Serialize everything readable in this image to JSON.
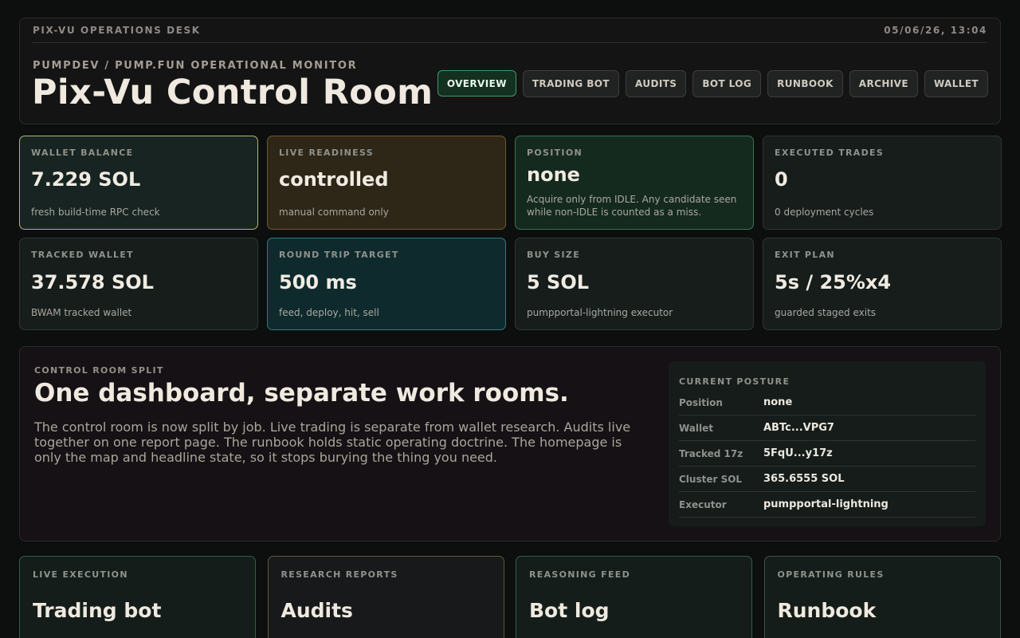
{
  "header": {
    "desk": "PIX-VU OPERATIONS DESK",
    "timestamp": "05/06/26, 13:04",
    "subtitle": "PUMPDEV / PUMP.FUN OPERATIONAL MONITOR",
    "title": "Pix-Vu Control Room"
  },
  "nav": {
    "tabs": [
      {
        "label": "OVERVIEW",
        "active": true
      },
      {
        "label": "TRADING BOT"
      },
      {
        "label": "AUDITS"
      },
      {
        "label": "BOT LOG"
      },
      {
        "label": "RUNBOOK"
      },
      {
        "label": "ARCHIVE"
      },
      {
        "label": "WALLET"
      }
    ]
  },
  "cards": [
    {
      "label": "WALLET BALANCE",
      "value": "7.229 SOL",
      "note": "fresh build-time RPC check"
    },
    {
      "label": "LIVE READINESS",
      "value": "controlled",
      "note": "manual command only"
    },
    {
      "label": "POSITION",
      "value": "none",
      "note": "Acquire only from IDLE. Any candidate seen while non-IDLE is counted as a miss."
    },
    {
      "label": "EXECUTED TRADES",
      "value": "0",
      "note": "0 deployment cycles"
    },
    {
      "label": "TRACKED WALLET",
      "value": "37.578 SOL",
      "note": "BWAM tracked wallet"
    },
    {
      "label": "ROUND TRIP TARGET",
      "value": "500 ms",
      "note": "feed, deploy, hit, sell"
    },
    {
      "label": "BUY SIZE",
      "value": "5 SOL",
      "note": "pumpportal-lightning executor"
    },
    {
      "label": "EXIT PLAN",
      "value": "5s / 25%x4",
      "note": "guarded staged exits"
    }
  ],
  "split": {
    "label": "CONTROL ROOM SPLIT",
    "title": "One dashboard, separate work rooms.",
    "body": "The control room is now split by job. Live trading is separate from wallet research. Audits live together on one report page. The runbook holds static operating doctrine. The homepage is only the map and headline state, so it stops burying the thing you need."
  },
  "posture": {
    "label": "CURRENT POSTURE",
    "rows": [
      {
        "key": "Position",
        "value": "none"
      },
      {
        "key": "Wallet",
        "value": "ABTc...VPG7"
      },
      {
        "key": "Tracked 17z",
        "value": "5FqU...y17z"
      },
      {
        "key": "Cluster SOL",
        "value": "365.6555 SOL"
      },
      {
        "key": "Executor",
        "value": "pumpportal-lightning"
      }
    ]
  },
  "rooms": [
    {
      "label": "LIVE EXECUTION",
      "title": "Trading bot"
    },
    {
      "label": "RESEARCH REPORTS",
      "title": "Audits"
    },
    {
      "label": "REASONING FEED",
      "title": "Bot log"
    },
    {
      "label": "OPERATING RULES",
      "title": "Runbook"
    }
  ]
}
